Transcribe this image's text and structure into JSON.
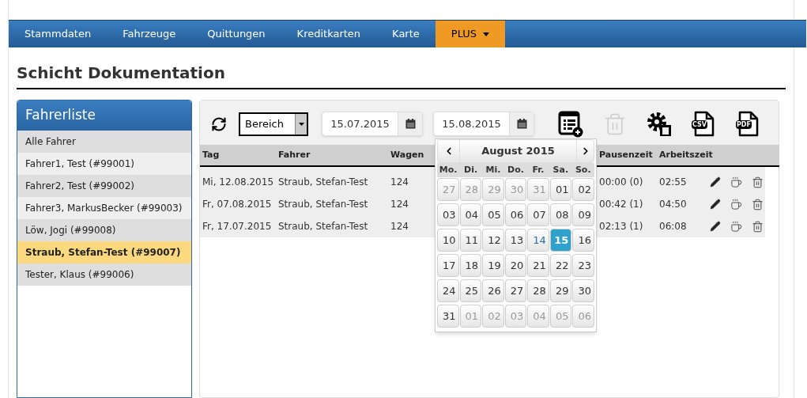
{
  "nav": [
    {
      "label": "Stammdaten",
      "selected": false,
      "has_menu": false
    },
    {
      "label": "Fahrzeuge",
      "selected": false,
      "has_menu": false
    },
    {
      "label": "Quittungen",
      "selected": false,
      "has_menu": false
    },
    {
      "label": "Kreditkarten",
      "selected": false,
      "has_menu": false
    },
    {
      "label": "Karte",
      "selected": false,
      "has_menu": false
    },
    {
      "label": "PLUS",
      "selected": true,
      "has_menu": true
    }
  ],
  "page_title": "Schicht Dokumentation",
  "sidebar": {
    "title": "Fahrerliste",
    "items": [
      {
        "label": "Alle Fahrer",
        "selected": false
      },
      {
        "label": "Fahrer1, Test (#99001)",
        "selected": false
      },
      {
        "label": "Fahrer2, Test (#99002)",
        "selected": false
      },
      {
        "label": "Fahrer3, MarkusBecker (#99003)",
        "selected": false
      },
      {
        "label": "Löw, Jogi (#99008)",
        "selected": false
      },
      {
        "label": "Straub, Stefan-Test (#99007)",
        "selected": true
      },
      {
        "label": "Tester, Klaus (#99006)",
        "selected": false
      }
    ]
  },
  "toolbar": {
    "range_select": "Bereich",
    "date_from": "15.07.2015",
    "date_to": "15.08.2015",
    "actions": [
      {
        "kind": "add",
        "disabled": false
      },
      {
        "kind": "delete",
        "disabled": true
      },
      {
        "kind": "settings",
        "disabled": false
      },
      {
        "kind": "file",
        "label": "CSV",
        "disabled": false
      },
      {
        "kind": "file",
        "label": "PDF",
        "disabled": false
      }
    ]
  },
  "table": {
    "columns": [
      "Tag",
      "Fahrer",
      "Wagen",
      "Pausenzeit",
      "Arbeitszeit"
    ],
    "rows": [
      {
        "cells": [
          "Mi, 12.08.2015",
          "Straub, Stefan-Test",
          "124",
          "00:00 (0)",
          "02:55"
        ]
      },
      {
        "cells": [
          "Fr, 07.08.2015",
          "Straub, Stefan-Test",
          "124",
          "00:42 (1)",
          "04:50"
        ]
      },
      {
        "cells": [
          "Fr, 17.07.2015",
          "Straub, Stefan-Test",
          "124",
          "02:13 (1)",
          "06:08"
        ]
      }
    ]
  },
  "calendar": {
    "month": "August 2015",
    "weekdays": [
      "Mo.",
      "Di.",
      "Mi.",
      "Do.",
      "Fr.",
      "Sa.",
      "So."
    ],
    "weeks": [
      [
        {
          "label": "27",
          "kind": "outside"
        },
        {
          "label": "28",
          "kind": "outside"
        },
        {
          "label": "29",
          "kind": "outside"
        },
        {
          "label": "30",
          "kind": "outside"
        },
        {
          "label": "31",
          "kind": "outside"
        },
        {
          "label": "01",
          "kind": "normal"
        },
        {
          "label": "02",
          "kind": "normal"
        }
      ],
      [
        {
          "label": "03",
          "kind": "normal"
        },
        {
          "label": "04",
          "kind": "normal"
        },
        {
          "label": "05",
          "kind": "normal"
        },
        {
          "label": "06",
          "kind": "normal"
        },
        {
          "label": "07",
          "kind": "normal"
        },
        {
          "label": "08",
          "kind": "normal"
        },
        {
          "label": "09",
          "kind": "normal"
        }
      ],
      [
        {
          "label": "10",
          "kind": "normal"
        },
        {
          "label": "11",
          "kind": "normal"
        },
        {
          "label": "12",
          "kind": "normal"
        },
        {
          "label": "13",
          "kind": "normal"
        },
        {
          "label": "14",
          "kind": "today"
        },
        {
          "label": "15",
          "kind": "selected"
        },
        {
          "label": "16",
          "kind": "normal"
        }
      ],
      [
        {
          "label": "17",
          "kind": "normal"
        },
        {
          "label": "18",
          "kind": "normal"
        },
        {
          "label": "19",
          "kind": "normal"
        },
        {
          "label": "20",
          "kind": "normal"
        },
        {
          "label": "21",
          "kind": "normal"
        },
        {
          "label": "22",
          "kind": "normal"
        },
        {
          "label": "23",
          "kind": "normal"
        }
      ],
      [
        {
          "label": "24",
          "kind": "normal"
        },
        {
          "label": "25",
          "kind": "normal"
        },
        {
          "label": "26",
          "kind": "normal"
        },
        {
          "label": "27",
          "kind": "normal"
        },
        {
          "label": "28",
          "kind": "normal"
        },
        {
          "label": "29",
          "kind": "normal"
        },
        {
          "label": "30",
          "kind": "normal"
        }
      ],
      [
        {
          "label": "31",
          "kind": "normal"
        },
        {
          "label": "01",
          "kind": "outside"
        },
        {
          "label": "02",
          "kind": "outside"
        },
        {
          "label": "03",
          "kind": "outside"
        },
        {
          "label": "04",
          "kind": "outside"
        },
        {
          "label": "05",
          "kind": "outside"
        },
        {
          "label": "06",
          "kind": "outside"
        }
      ]
    ]
  }
}
